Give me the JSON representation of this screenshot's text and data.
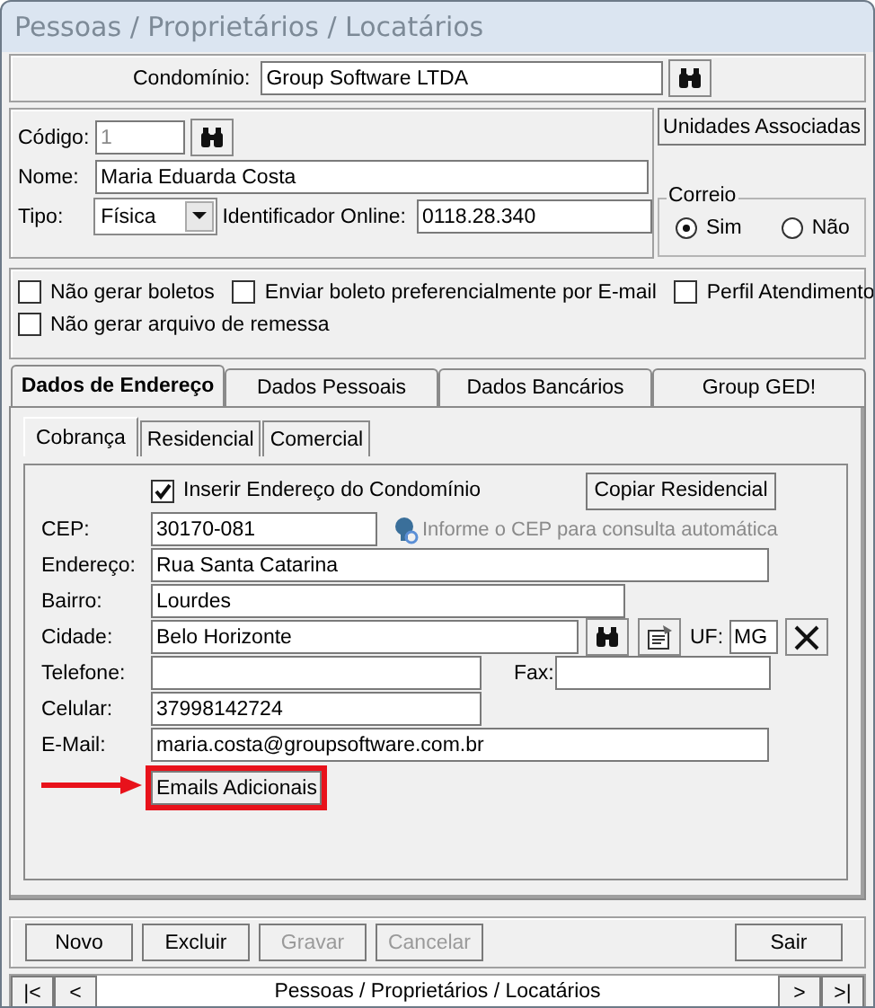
{
  "window": {
    "title": "Pessoas / Proprietários / Locatários"
  },
  "condominio": {
    "label": "Condomínio:",
    "value": "Group Software LTDA"
  },
  "pessoa": {
    "codigo": {
      "label": "Código:",
      "value": "1",
      "disabled": true
    },
    "nome": {
      "label": "Nome:",
      "value": "Maria Eduarda Costa"
    },
    "tipo": {
      "label": "Tipo:",
      "value": "Física"
    },
    "identificador": {
      "label": "Identificador Online:",
      "value": "0118.28.340"
    }
  },
  "unidades_button": "Unidades Associadas",
  "correio": {
    "title": "Correio",
    "options": [
      {
        "label": "Sim",
        "selected": true
      },
      {
        "label": "Não",
        "selected": false
      }
    ]
  },
  "flags": [
    {
      "label": "Não gerar boletos",
      "checked": false
    },
    {
      "label": "Enviar boleto preferencialmente por E-mail",
      "checked": false
    },
    {
      "label": "Perfil Atendimento",
      "checked": false
    },
    {
      "label": "Não gerar arquivo de remessa",
      "checked": false
    }
  ],
  "tabs": [
    {
      "label": "Dados de Endereço",
      "selected": true
    },
    {
      "label": "Dados Pessoais",
      "selected": false
    },
    {
      "label": "Dados Bancários",
      "selected": false
    },
    {
      "label": "Group GED!",
      "selected": false
    }
  ],
  "subtabs": [
    {
      "label": "Cobrança",
      "selected": true
    },
    {
      "label": "Residencial",
      "selected": false
    },
    {
      "label": "Comercial",
      "selected": false
    }
  ],
  "endereco": {
    "inserir": {
      "label": "Inserir Endereço do Condomínio",
      "checked": true
    },
    "copiar_button": "Copiar Residencial",
    "cep": {
      "label": "CEP:",
      "value": "30170-081"
    },
    "cep_hint": "Informe o CEP para consulta automática",
    "logradouro": {
      "label": "Endereço:",
      "value": "Rua Santa Catarina"
    },
    "bairro": {
      "label": "Bairro:",
      "value": "Lourdes"
    },
    "cidade": {
      "label": "Cidade:",
      "value": "Belo Horizonte"
    },
    "uf": {
      "label": "UF:",
      "value": "MG"
    },
    "telefone": {
      "label": "Telefone:"
    },
    "fax": {
      "label": "Fax:"
    },
    "celular": {
      "label": "Celular:",
      "value": "37998142724"
    },
    "email": {
      "label": "E-Mail:",
      "value": "maria.costa@groupsoftware.com.br"
    },
    "emails_button": {
      "label": "Emails Adicionais",
      "highlighted": true
    }
  },
  "buttons": [
    {
      "label": "Novo",
      "disabled": false
    },
    {
      "label": "Excluir",
      "disabled": false
    },
    {
      "label": "Gravar",
      "disabled": true
    },
    {
      "label": "Cancelar",
      "disabled": true
    },
    {
      "label": "Sair",
      "disabled": false
    }
  ],
  "navigator": {
    "first": "|<",
    "prev": "<",
    "caption": "Pessoas / Proprietários / Locatários",
    "next": ">",
    "last": ">|"
  }
}
